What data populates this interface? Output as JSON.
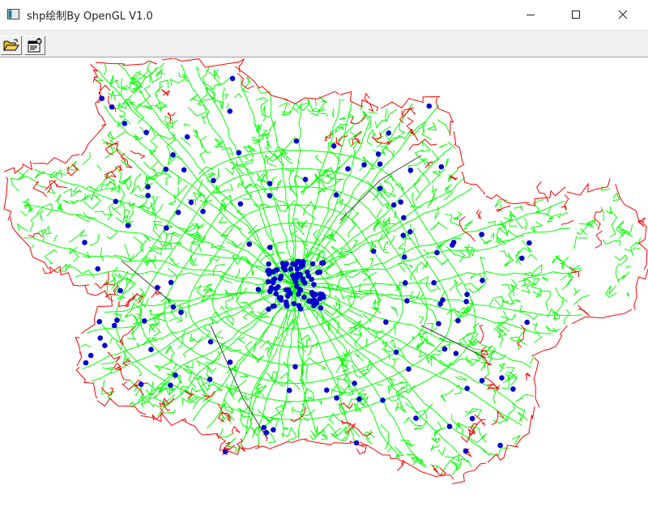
{
  "window": {
    "title": "shp绘制By OpenGL V1.0",
    "controls": [
      "minimize",
      "maximize",
      "close"
    ]
  },
  "toolbar": {
    "buttons": [
      {
        "icon": "open-folder-icon"
      },
      {
        "icon": "properties-icon"
      }
    ]
  },
  "map": {
    "colors": {
      "roads": "#00ff00",
      "boundary": "#ff0000",
      "points": "#0000cc",
      "dark_lines": "#404040"
    }
  }
}
